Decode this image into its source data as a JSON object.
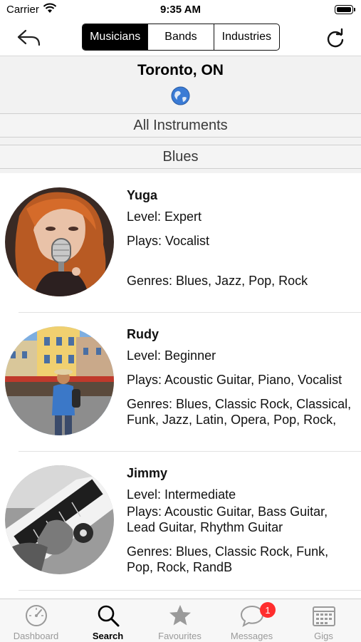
{
  "status_bar": {
    "carrier": "Carrier",
    "time": "9:35 AM"
  },
  "nav": {
    "segments": [
      "Musicians",
      "Bands",
      "Industries"
    ],
    "active_segment": "Musicians"
  },
  "header": {
    "city": "Toronto, ON",
    "instrument_filter": "All Instruments",
    "genre_filter": "Blues"
  },
  "musicians": [
    {
      "name": "Yuga",
      "level": "Level: Expert",
      "plays": "Plays: Vocalist",
      "genres": "Genres: Blues, Jazz, Pop, Rock"
    },
    {
      "name": "Rudy",
      "level": "Level: Beginner",
      "plays": "Plays: Acoustic Guitar, Piano, Vocalist",
      "genres": "Genres: Blues, Classic Rock, Classical, Funk, Jazz, Latin, Opera, Pop, Rock,"
    },
    {
      "name": "Jimmy",
      "level": "Level: Intermediate",
      "plays": "Plays: Acoustic Guitar, Bass Guitar, Lead Guitar, Rhythm Guitar",
      "genres": "Genres: Blues, Classic Rock, Funk, Pop, Rock, RandB"
    }
  ],
  "tabs": [
    {
      "label": "Dashboard",
      "icon": "speedometer-icon"
    },
    {
      "label": "Search",
      "icon": "search-icon"
    },
    {
      "label": "Favourites",
      "icon": "star-icon"
    },
    {
      "label": "Messages",
      "icon": "chat-bubble-icon",
      "badge": "1"
    },
    {
      "label": "Gigs",
      "icon": "calendar-icon"
    }
  ],
  "active_tab": "Search",
  "colors": {
    "accent": "#000000",
    "badge": "#ff2d2d",
    "inactive_tab": "#9a9a9a",
    "globe": "#3a7bd5"
  }
}
